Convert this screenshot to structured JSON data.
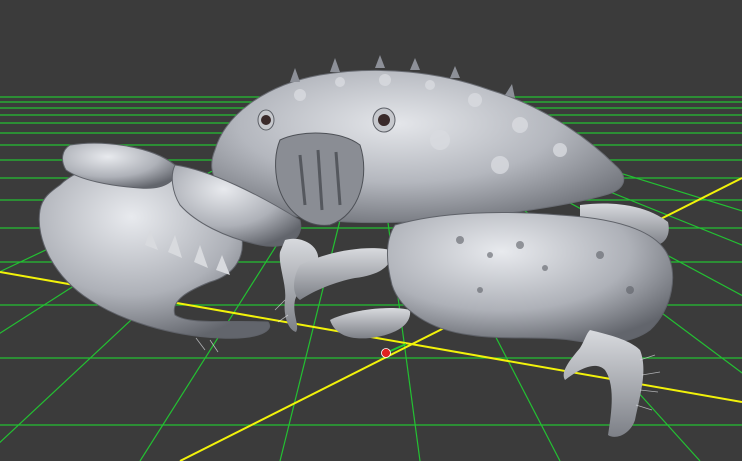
{
  "viewport": {
    "background_color": "#3b3b3b",
    "grid_color": "#22c832",
    "axis_color": "#f2f20a",
    "model_color": "#c2c5cb",
    "model": "crab-3d-model",
    "gizmo_icon": "transform-gizmo-icon"
  }
}
